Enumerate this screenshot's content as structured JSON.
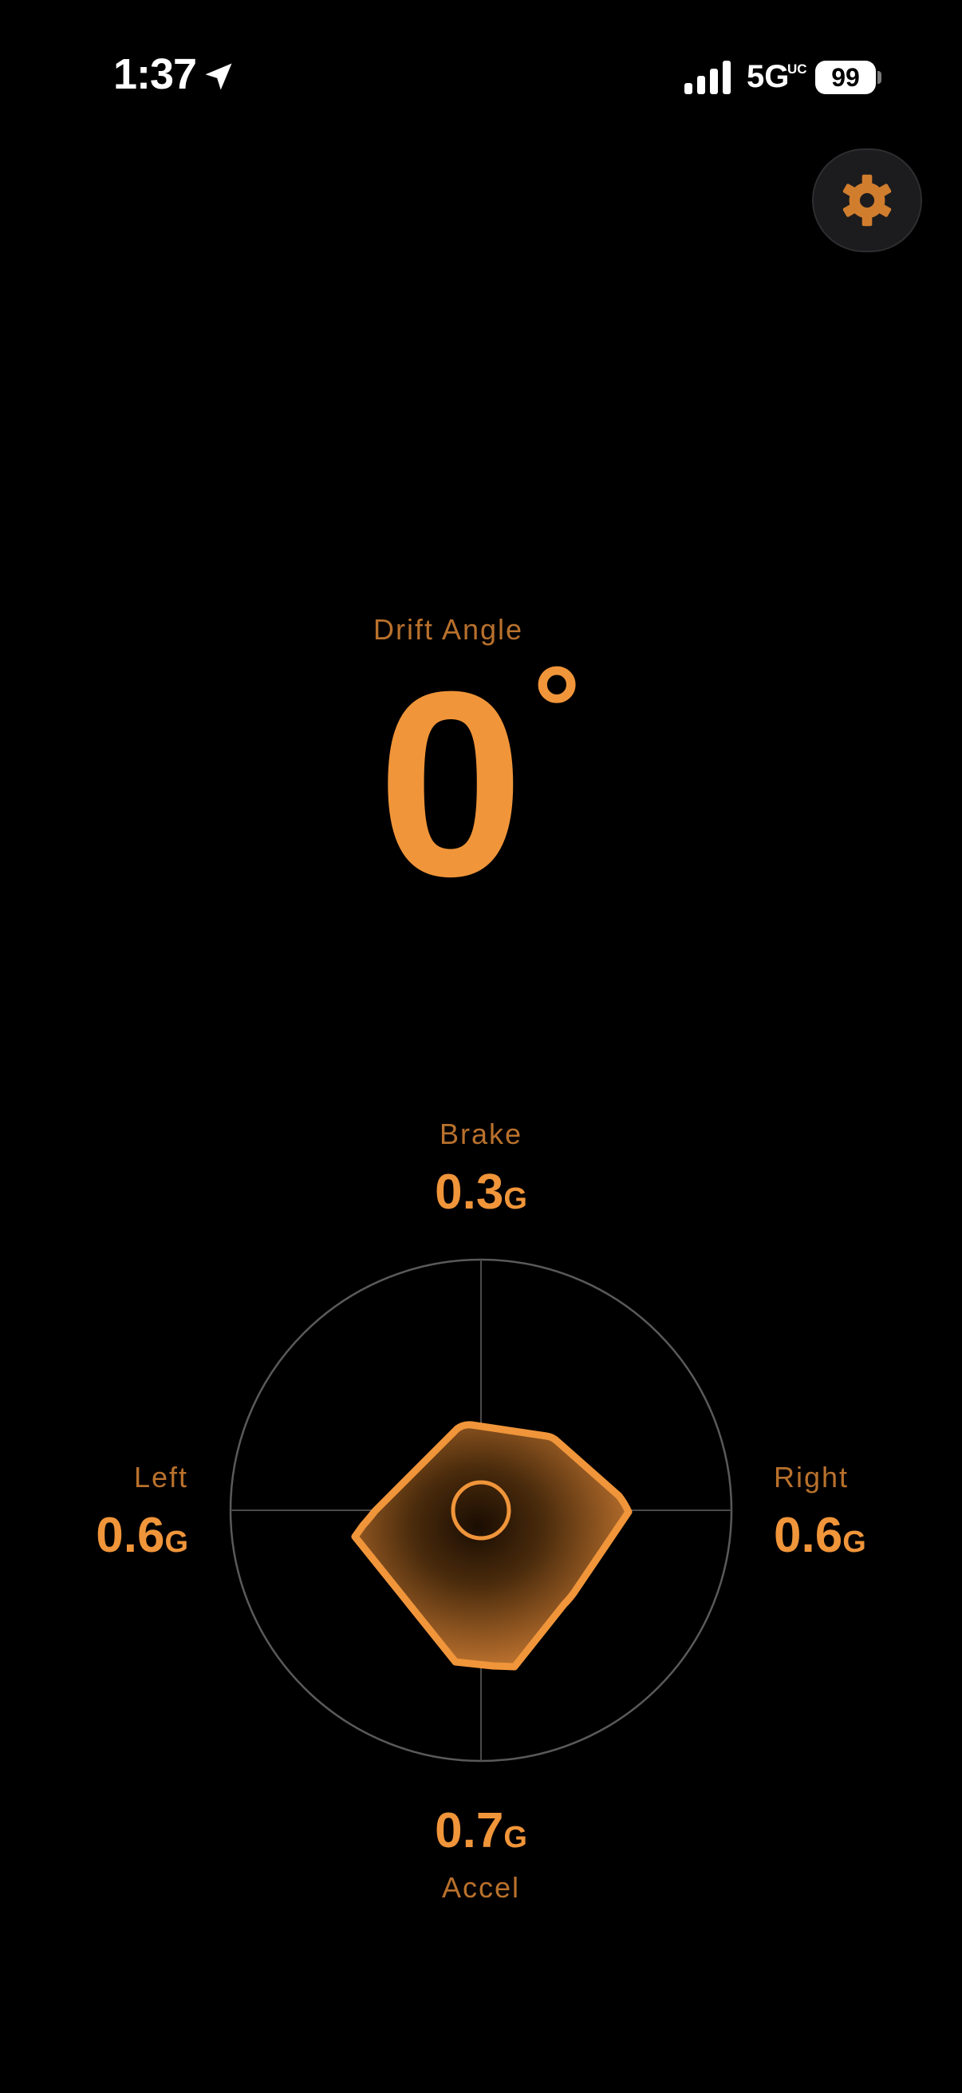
{
  "status_bar": {
    "time": "1:37",
    "network": "5G",
    "network_sup": "UC",
    "battery": "99"
  },
  "icons": {
    "location": "location-arrow-icon",
    "signal": "cellular-signal-icon",
    "settings": "gear-icon"
  },
  "drift": {
    "label": "Drift Angle",
    "value": "0",
    "unit": "°"
  },
  "gforce": {
    "brake": {
      "label": "Brake",
      "value": "0.3",
      "unit": "G"
    },
    "left": {
      "label": "Left",
      "value": "0.6",
      "unit": "G"
    },
    "right": {
      "label": "Right",
      "value": "0.6",
      "unit": "G"
    },
    "accel": {
      "label": "Accel",
      "value": "0.7",
      "unit": "G"
    }
  },
  "colors": {
    "accent": "#f0953a",
    "label": "#b9712c",
    "background": "#000000",
    "ring": "#5a5a5a"
  }
}
